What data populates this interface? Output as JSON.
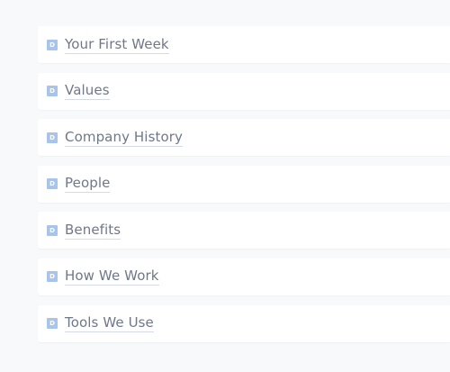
{
  "documents": [
    {
      "badge": "D",
      "title": "Your First Week"
    },
    {
      "badge": "D",
      "title": "Values"
    },
    {
      "badge": "D",
      "title": "Company History"
    },
    {
      "badge": "D",
      "title": "People"
    },
    {
      "badge": "D",
      "title": "Benefits"
    },
    {
      "badge": "D",
      "title": "How We Work"
    },
    {
      "badge": "D",
      "title": "Tools We Use"
    }
  ],
  "colors": {
    "page_background": "#f8f9fb",
    "row_background": "#ffffff",
    "badge": "#a8c4ea",
    "title_text": "#6f7888"
  },
  "icons": {
    "document_badge": "document-icon"
  }
}
